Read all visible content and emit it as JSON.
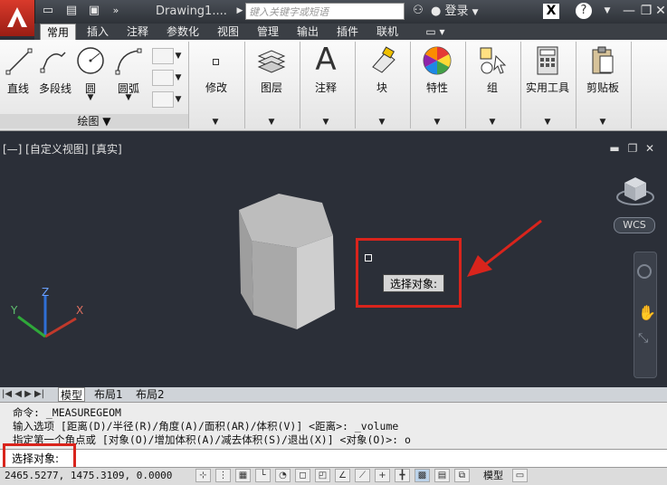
{
  "titlebar": {
    "document_title": "Drawing1....",
    "search_placeholder": "键入关键字或短语",
    "login_label": "登录",
    "help_label": "?"
  },
  "tabs": [
    "常用",
    "插入",
    "注释",
    "参数化",
    "视图",
    "管理",
    "输出",
    "插件",
    "联机"
  ],
  "ribbon": {
    "draw_tools": [
      "直线",
      "多段线",
      "圆",
      "圆弧"
    ],
    "draw_panel_title": "绘图 ▼",
    "panels": [
      "修改",
      "图层",
      "注释",
      "块",
      "特性",
      "组",
      "实用工具",
      "剪贴板"
    ]
  },
  "viewport": {
    "label": "[—] [自定义视图] [真实]",
    "tooltip": "选择对象:",
    "wcs_label": "WCS",
    "axis_x": "X",
    "axis_y": "Y",
    "axis_z": "Z"
  },
  "layout_tabs": [
    "模型",
    "布局1",
    "布局2"
  ],
  "command": {
    "line1": "命令: _MEASUREGEOM",
    "line2": "输入选项 [距离(D)/半径(R)/角度(A)/面积(AR)/体积(V)] <距离>: _volume",
    "line3": "指定第一个角点或 [对象(O)/增加体积(A)/减去体积(S)/退出(X)] <对象(O)>: o",
    "prompt": "选择对象:"
  },
  "status": {
    "coordinates": "2465.5277, 1475.3109, 0.0000",
    "model_label": "模型"
  },
  "colors": {
    "highlight_red": "#d9241c",
    "viewport_bg": "#2b2f38",
    "app_red": "#c8281c"
  }
}
